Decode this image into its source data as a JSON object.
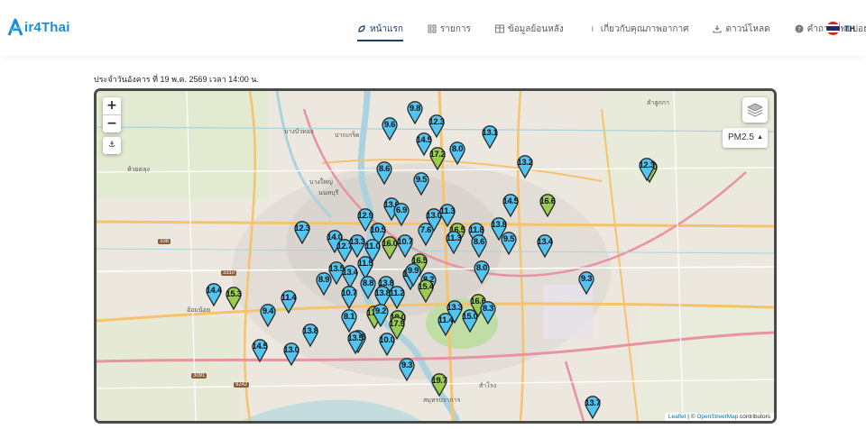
{
  "brand": {
    "name": "ir4Thai",
    "accent": "#1a8dd8"
  },
  "nav": {
    "items": [
      {
        "label": "หน้าแรก",
        "icon": "leaf-icon",
        "active": true
      },
      {
        "label": "รายการ",
        "icon": "grid-icon",
        "active": false
      },
      {
        "label": "ข้อมูลย้อนหลัง",
        "icon": "table-icon",
        "active": false
      },
      {
        "label": "เกี่ยวกับคุณภาพอากาศ",
        "icon": "info-icon",
        "active": false
      },
      {
        "label": "ดาวน์โหลด",
        "icon": "download-icon",
        "active": false
      },
      {
        "label": "คำถามที่พบบ่อย",
        "icon": "question-icon",
        "active": false
      }
    ],
    "language": "TH"
  },
  "announcement": "ประจำวันอังคาร ที่ 19 พ.ค. 2569 เวลา 14:00 น.",
  "map": {
    "controls": {
      "zoom_in": "+",
      "zoom_out": "−",
      "locate_icon": "anchor-icon",
      "layers_icon": "layers-icon"
    },
    "pollutant_select": "PM2.5",
    "attribution": {
      "leaflet": "Leaflet",
      "sep": " | © ",
      "osm": "OpenStreetMap",
      "rest": " contributors"
    },
    "colors": {
      "blue": "#52c5f2",
      "green": "#9ccd52",
      "stroke": "#2a2a2a"
    },
    "place_labels": [
      {
        "text": "ปากเกร็ด"
      },
      {
        "text": "บางบัวทอง"
      },
      {
        "text": "นนทบุรี"
      },
      {
        "text": "บางใหญ่"
      },
      {
        "text": "ห้วยตลุง"
      },
      {
        "text": "อ้อมน้อย"
      },
      {
        "text": "สำโรง"
      },
      {
        "text": "สมุทรปราการ"
      },
      {
        "text": "ลำลูกกา"
      }
    ],
    "road_numbers": [
      "338",
      "3310",
      "3091",
      "9242"
    ],
    "stations": [
      {
        "value": "9.8",
        "level": "blue"
      },
      {
        "value": "12.3",
        "level": "blue"
      },
      {
        "value": "9.6",
        "level": "blue"
      },
      {
        "value": "14.5",
        "level": "blue"
      },
      {
        "value": "8.0",
        "level": "blue"
      },
      {
        "value": "17.2",
        "level": "green"
      },
      {
        "value": "13.1",
        "level": "blue"
      },
      {
        "value": "13.2",
        "level": "blue"
      },
      {
        "value": "17.0",
        "level": "green"
      },
      {
        "value": "8.6",
        "level": "blue"
      },
      {
        "value": "9.5",
        "level": "blue"
      },
      {
        "value": "14.5",
        "level": "blue"
      },
      {
        "value": "16.6",
        "level": "green"
      },
      {
        "value": "13.6",
        "level": "blue"
      },
      {
        "value": "6.9",
        "level": "blue"
      },
      {
        "value": "12.9",
        "level": "blue"
      },
      {
        "value": "13.0",
        "level": "blue"
      },
      {
        "value": "11.3",
        "level": "blue"
      },
      {
        "value": "13.8",
        "level": "blue"
      },
      {
        "value": "12.3",
        "level": "blue"
      },
      {
        "value": "14.0",
        "level": "blue"
      },
      {
        "value": "10.5",
        "level": "blue"
      },
      {
        "value": "11.0",
        "level": "blue"
      },
      {
        "value": "7.6",
        "level": "blue"
      },
      {
        "value": "16.5",
        "level": "green"
      },
      {
        "value": "11.8",
        "level": "blue"
      },
      {
        "value": "11.3",
        "level": "blue"
      },
      {
        "value": "8.6",
        "level": "blue"
      },
      {
        "value": "9.5",
        "level": "blue"
      },
      {
        "value": "13.4",
        "level": "blue"
      },
      {
        "value": "12.7",
        "level": "blue"
      },
      {
        "value": "13.3",
        "level": "blue"
      },
      {
        "value": "16.0",
        "level": "green"
      },
      {
        "value": "10.7",
        "level": "blue"
      },
      {
        "value": "11.5",
        "level": "blue"
      },
      {
        "value": "13.5",
        "level": "blue"
      },
      {
        "value": "16.5",
        "level": "green"
      },
      {
        "value": "13.4",
        "level": "blue"
      },
      {
        "value": "8.9",
        "level": "blue"
      },
      {
        "value": "8.8",
        "level": "blue"
      },
      {
        "value": "13.8",
        "level": "blue"
      },
      {
        "value": "10.9",
        "level": "blue"
      },
      {
        "value": "9.9",
        "level": "blue"
      },
      {
        "value": "8.2",
        "level": "blue"
      },
      {
        "value": "8.0",
        "level": "blue"
      },
      {
        "value": "9.3",
        "level": "blue"
      },
      {
        "value": "10.7",
        "level": "blue"
      },
      {
        "value": "13.8",
        "level": "blue"
      },
      {
        "value": "11.2",
        "level": "blue"
      },
      {
        "value": "15.4",
        "level": "green"
      },
      {
        "value": "14.4",
        "level": "blue"
      },
      {
        "value": "15.3",
        "level": "green"
      },
      {
        "value": "11.4",
        "level": "blue"
      },
      {
        "value": "13.3",
        "level": "blue"
      },
      {
        "value": "16.6",
        "level": "green"
      },
      {
        "value": "8.3",
        "level": "blue"
      },
      {
        "value": "9.4",
        "level": "blue"
      },
      {
        "value": "17.9",
        "level": "green"
      },
      {
        "value": "9.2",
        "level": "blue"
      },
      {
        "value": "8.1",
        "level": "blue"
      },
      {
        "value": "18.0",
        "level": "green"
      },
      {
        "value": "11.4",
        "level": "blue"
      },
      {
        "value": "15.0",
        "level": "blue"
      },
      {
        "value": "13.8",
        "level": "blue"
      },
      {
        "value": "17.9",
        "level": "green"
      },
      {
        "value": "11.5",
        "level": "blue"
      },
      {
        "value": "10.0",
        "level": "blue"
      },
      {
        "value": "14.5",
        "level": "blue"
      },
      {
        "value": "13.0",
        "level": "blue"
      },
      {
        "value": "9.3",
        "level": "blue"
      },
      {
        "value": "19.7",
        "level": "green"
      },
      {
        "value": "13.7",
        "level": "blue"
      },
      {
        "value": "12.3",
        "level": "blue"
      },
      {
        "value": "13.5",
        "level": "blue"
      }
    ]
  }
}
